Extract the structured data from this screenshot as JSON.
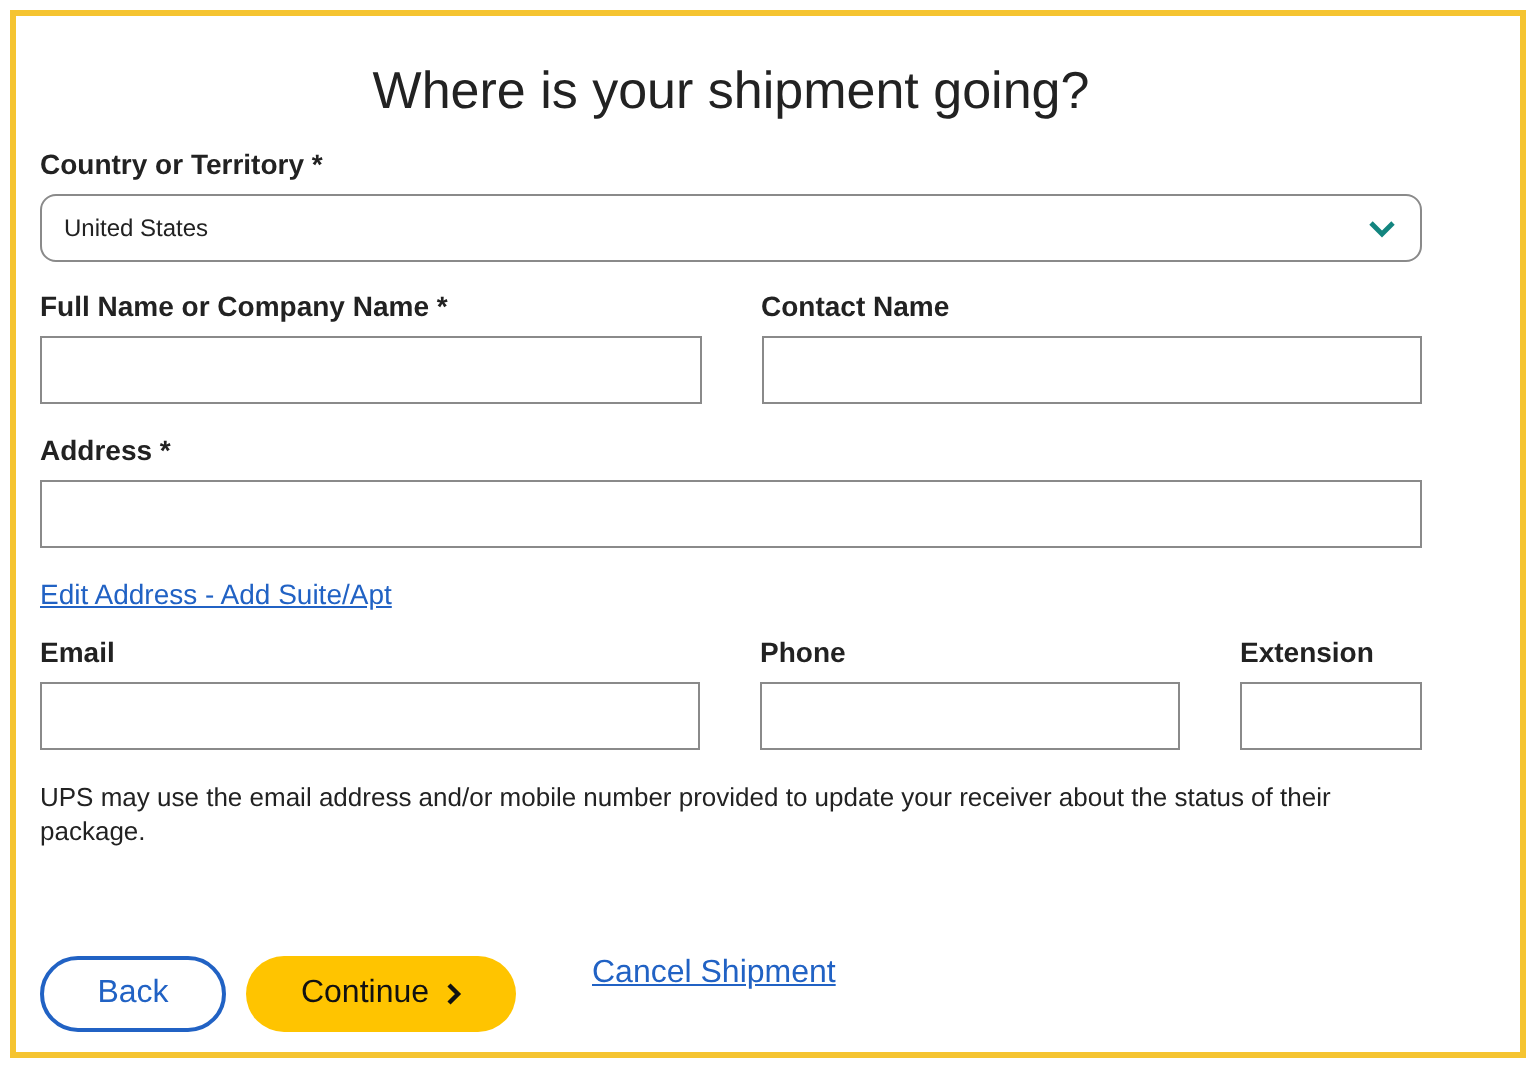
{
  "title": "Where is your shipment going?",
  "country": {
    "label": "Country or Territory *",
    "value": "United States"
  },
  "field_rows": [
    {
      "fields": [
        {
          "label": "Full Name or Company Name *"
        },
        {
          "label": "Contact Name"
        }
      ]
    },
    {
      "fields": [
        {
          "label": "Address *"
        }
      ]
    },
    {
      "link": "Edit Address - Add Suite/Apt"
    },
    {
      "fields": [
        {
          "label": "Email"
        },
        {
          "label": "Phone"
        },
        {
          "label": "Extension"
        }
      ]
    }
  ],
  "notice": "UPS may use the email address and/or mobile number provided to update your receiver about the status of their package.",
  "buttons": [
    {
      "label": "Back",
      "kind": "secondary"
    },
    {
      "label": "Continue",
      "kind": "primary"
    }
  ],
  "cancel_link": "Cancel Shipment"
}
